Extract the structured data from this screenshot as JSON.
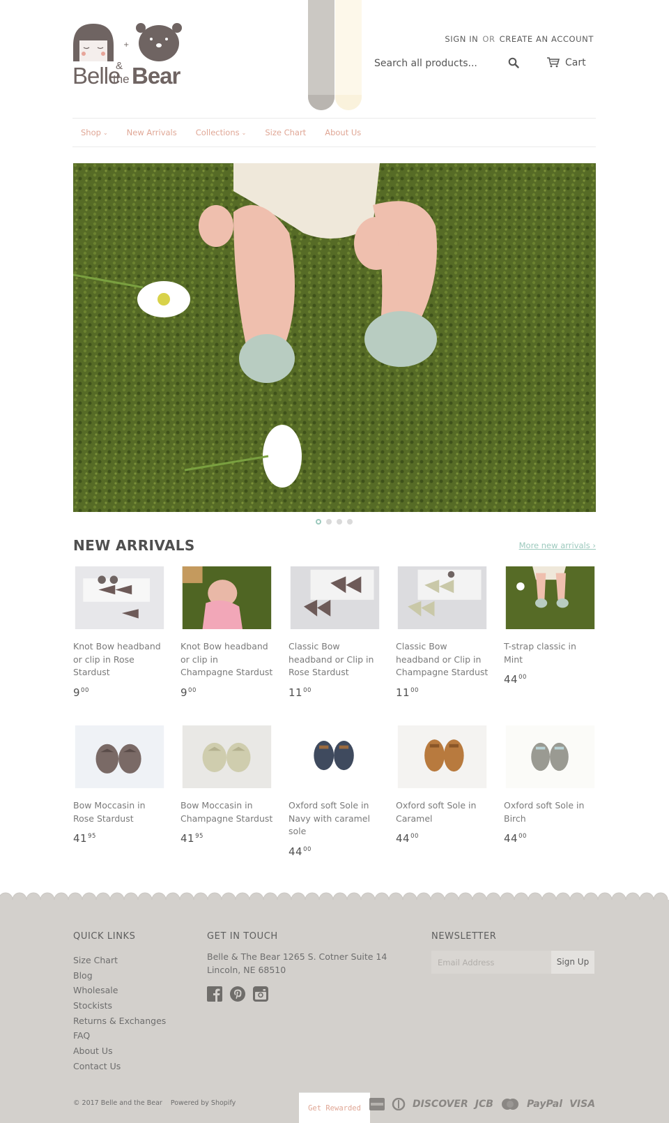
{
  "brand": {
    "logo_word_1": "Belle",
    "logo_amp": "&",
    "logo_the": "the",
    "logo_word_2": "Bear"
  },
  "header": {
    "sign_in": "SIGN IN",
    "or": "OR",
    "create_account": "CREATE AN ACCOUNT",
    "search_placeholder": "Search all products...",
    "cart_label": "Cart"
  },
  "nav": {
    "items": [
      {
        "label": "Shop",
        "has_dropdown": true
      },
      {
        "label": "New Arrivals",
        "has_dropdown": false
      },
      {
        "label": "Collections",
        "has_dropdown": true
      },
      {
        "label": "Size Chart",
        "has_dropdown": false
      },
      {
        "label": "About Us",
        "has_dropdown": false
      }
    ]
  },
  "hero": {
    "slide_count": 4,
    "active_slide": 1
  },
  "new_arrivals": {
    "title": "NEW ARRIVALS",
    "more_link": "More new arrivals ›",
    "products": [
      {
        "name": "Knot Bow headband or clip in Rose Stardust",
        "price_main": "9",
        "price_cents": "00"
      },
      {
        "name": "Knot Bow headband or clip in Champagne Stardust",
        "price_main": "9",
        "price_cents": "00"
      },
      {
        "name": "Classic Bow headband or Clip in Rose Stardust",
        "price_main": "11",
        "price_cents": "00"
      },
      {
        "name": "Classic Bow headband or Clip in Champagne Stardust",
        "price_main": "11",
        "price_cents": "00"
      },
      {
        "name": "T-strap classic in Mint",
        "price_main": "44",
        "price_cents": "00"
      },
      {
        "name": "Bow Moccasin in Rose Stardust",
        "price_main": "41",
        "price_cents": "95"
      },
      {
        "name": "Bow Moccasin in Champagne Stardust",
        "price_main": "41",
        "price_cents": "95"
      },
      {
        "name": "Oxford soft Sole in Navy with caramel sole",
        "price_main": "44",
        "price_cents": "00"
      },
      {
        "name": "Oxford soft Sole in Caramel",
        "price_main": "44",
        "price_cents": "00"
      },
      {
        "name": "Oxford soft Sole in Birch",
        "price_main": "44",
        "price_cents": "00"
      }
    ]
  },
  "footer": {
    "quick_links_title": "QUICK LINKS",
    "quick_links": [
      "Size Chart",
      "Blog",
      "Wholesale",
      "Stockists",
      "Returns & Exchanges",
      "FAQ",
      "About Us",
      "Contact Us"
    ],
    "contact_title": "GET IN TOUCH",
    "address": "Belle & The Bear 1265 S. Cotner Suite 14 Lincoln, NE 68510",
    "social_icons": [
      "facebook-icon",
      "pinterest-icon",
      "instagram-icon"
    ],
    "newsletter_title": "NEWSLETTER",
    "email_placeholder": "Email Address",
    "signup_label": "Sign Up",
    "copyright": "© 2017 Belle and the Bear",
    "powered_by": "Powered by Shopify",
    "rewarded_label": "Get Rewarded",
    "payment_methods": [
      "amex-icon",
      "diners-icon",
      "DISCOVER",
      "JCB",
      "mastercard-icon",
      "PayPal",
      "VISA"
    ]
  },
  "colors": {
    "nav_link": "#e0a796",
    "accent": "#9cc9bd",
    "footer_bg": "#d3d0cc",
    "heading": "#4f4f4f"
  }
}
